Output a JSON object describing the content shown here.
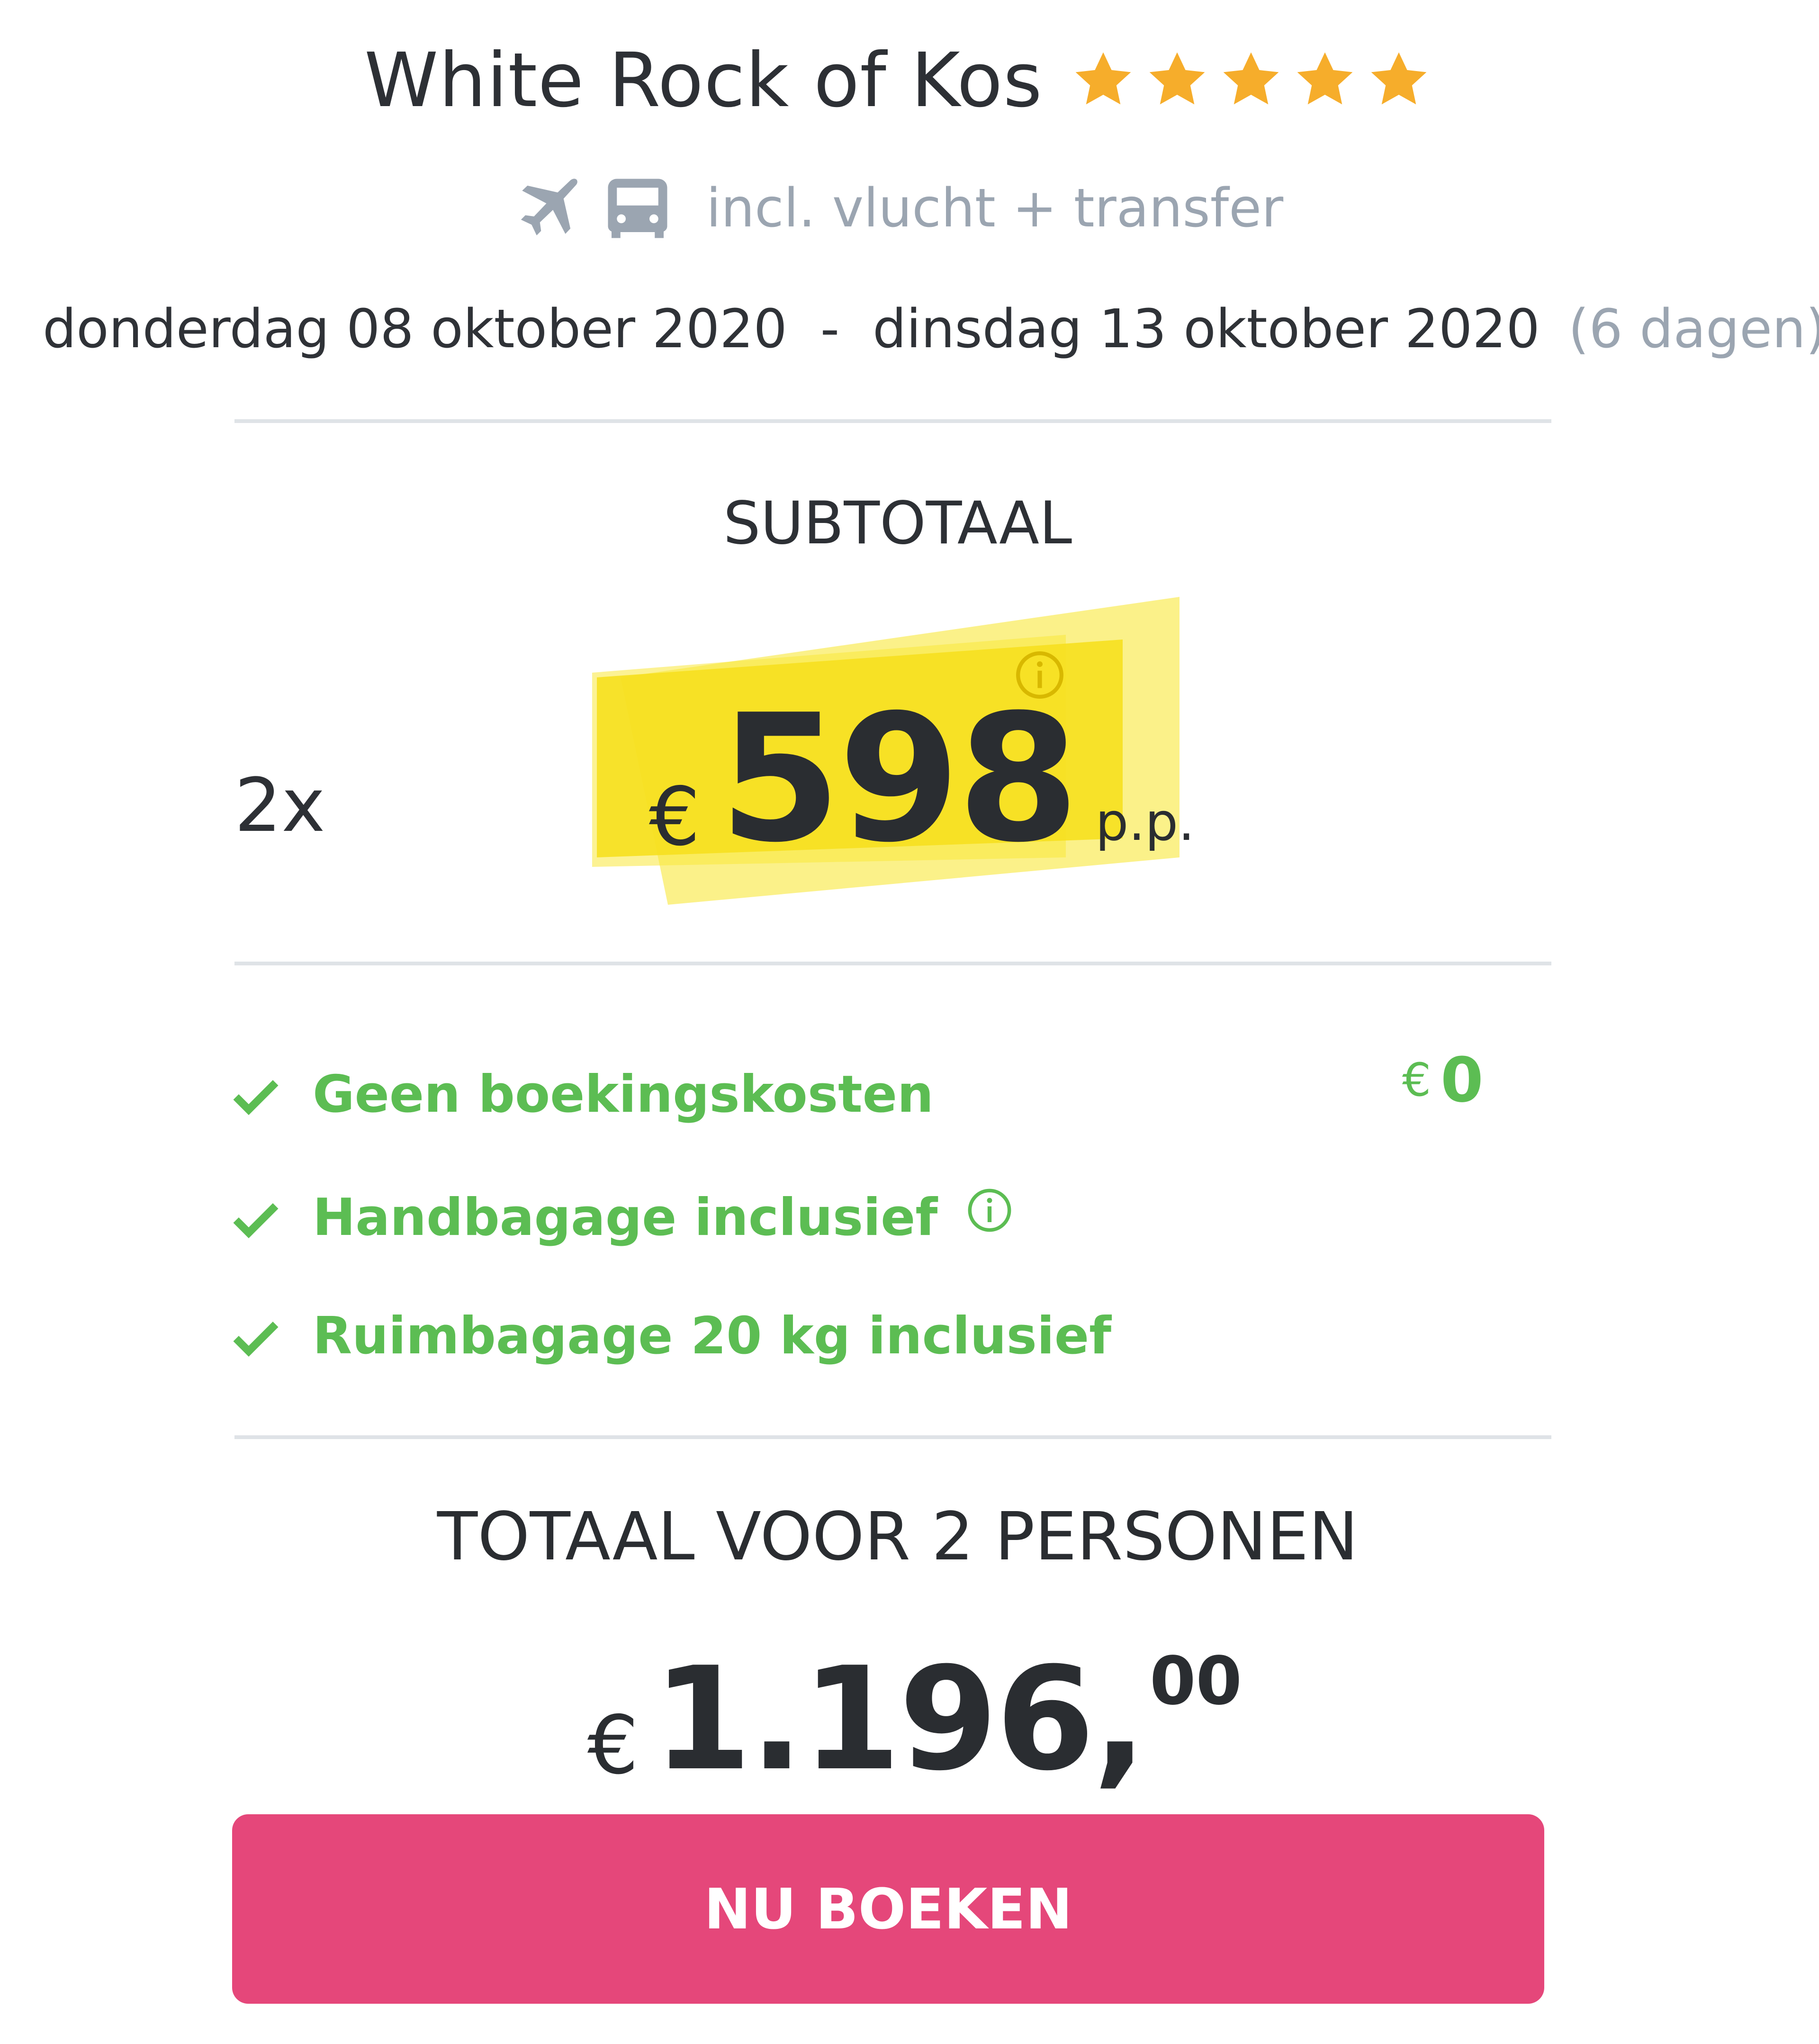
{
  "header": {
    "hotel_name": "White Rock of Kos",
    "star_rating": 5,
    "star_color": "#f6ad2b",
    "transport_icons": [
      "plane-icon",
      "bus-icon"
    ],
    "inclusion_text": "incl. vlucht + transfer"
  },
  "dates": {
    "from": "donderdag 08 oktober 2020",
    "separator": "-",
    "to": "dinsdag 13 oktober 2020",
    "duration": "(6 dagen)"
  },
  "subtotal": {
    "label": "SUBTOTAAL",
    "quantity": "2x",
    "currency": "€",
    "price": "598",
    "unit": "p.p.",
    "highlight_color": "#f9e73b"
  },
  "inclusions": {
    "items": [
      {
        "label": "Geen boekingskosten"
      },
      {
        "label": "Handbagage inclusief"
      },
      {
        "label": "Ruimbagage 20 kg inclusief"
      }
    ],
    "booking_fee_currency": "€",
    "booking_fee_value": "0",
    "color": "#5cbd53"
  },
  "total": {
    "label": "TOTAAL VOOR 2 PERSONEN",
    "currency": "€",
    "amount": "1.196,",
    "cents": "00"
  },
  "cta": {
    "label": "NU BOEKEN",
    "color": "#e5477a"
  }
}
